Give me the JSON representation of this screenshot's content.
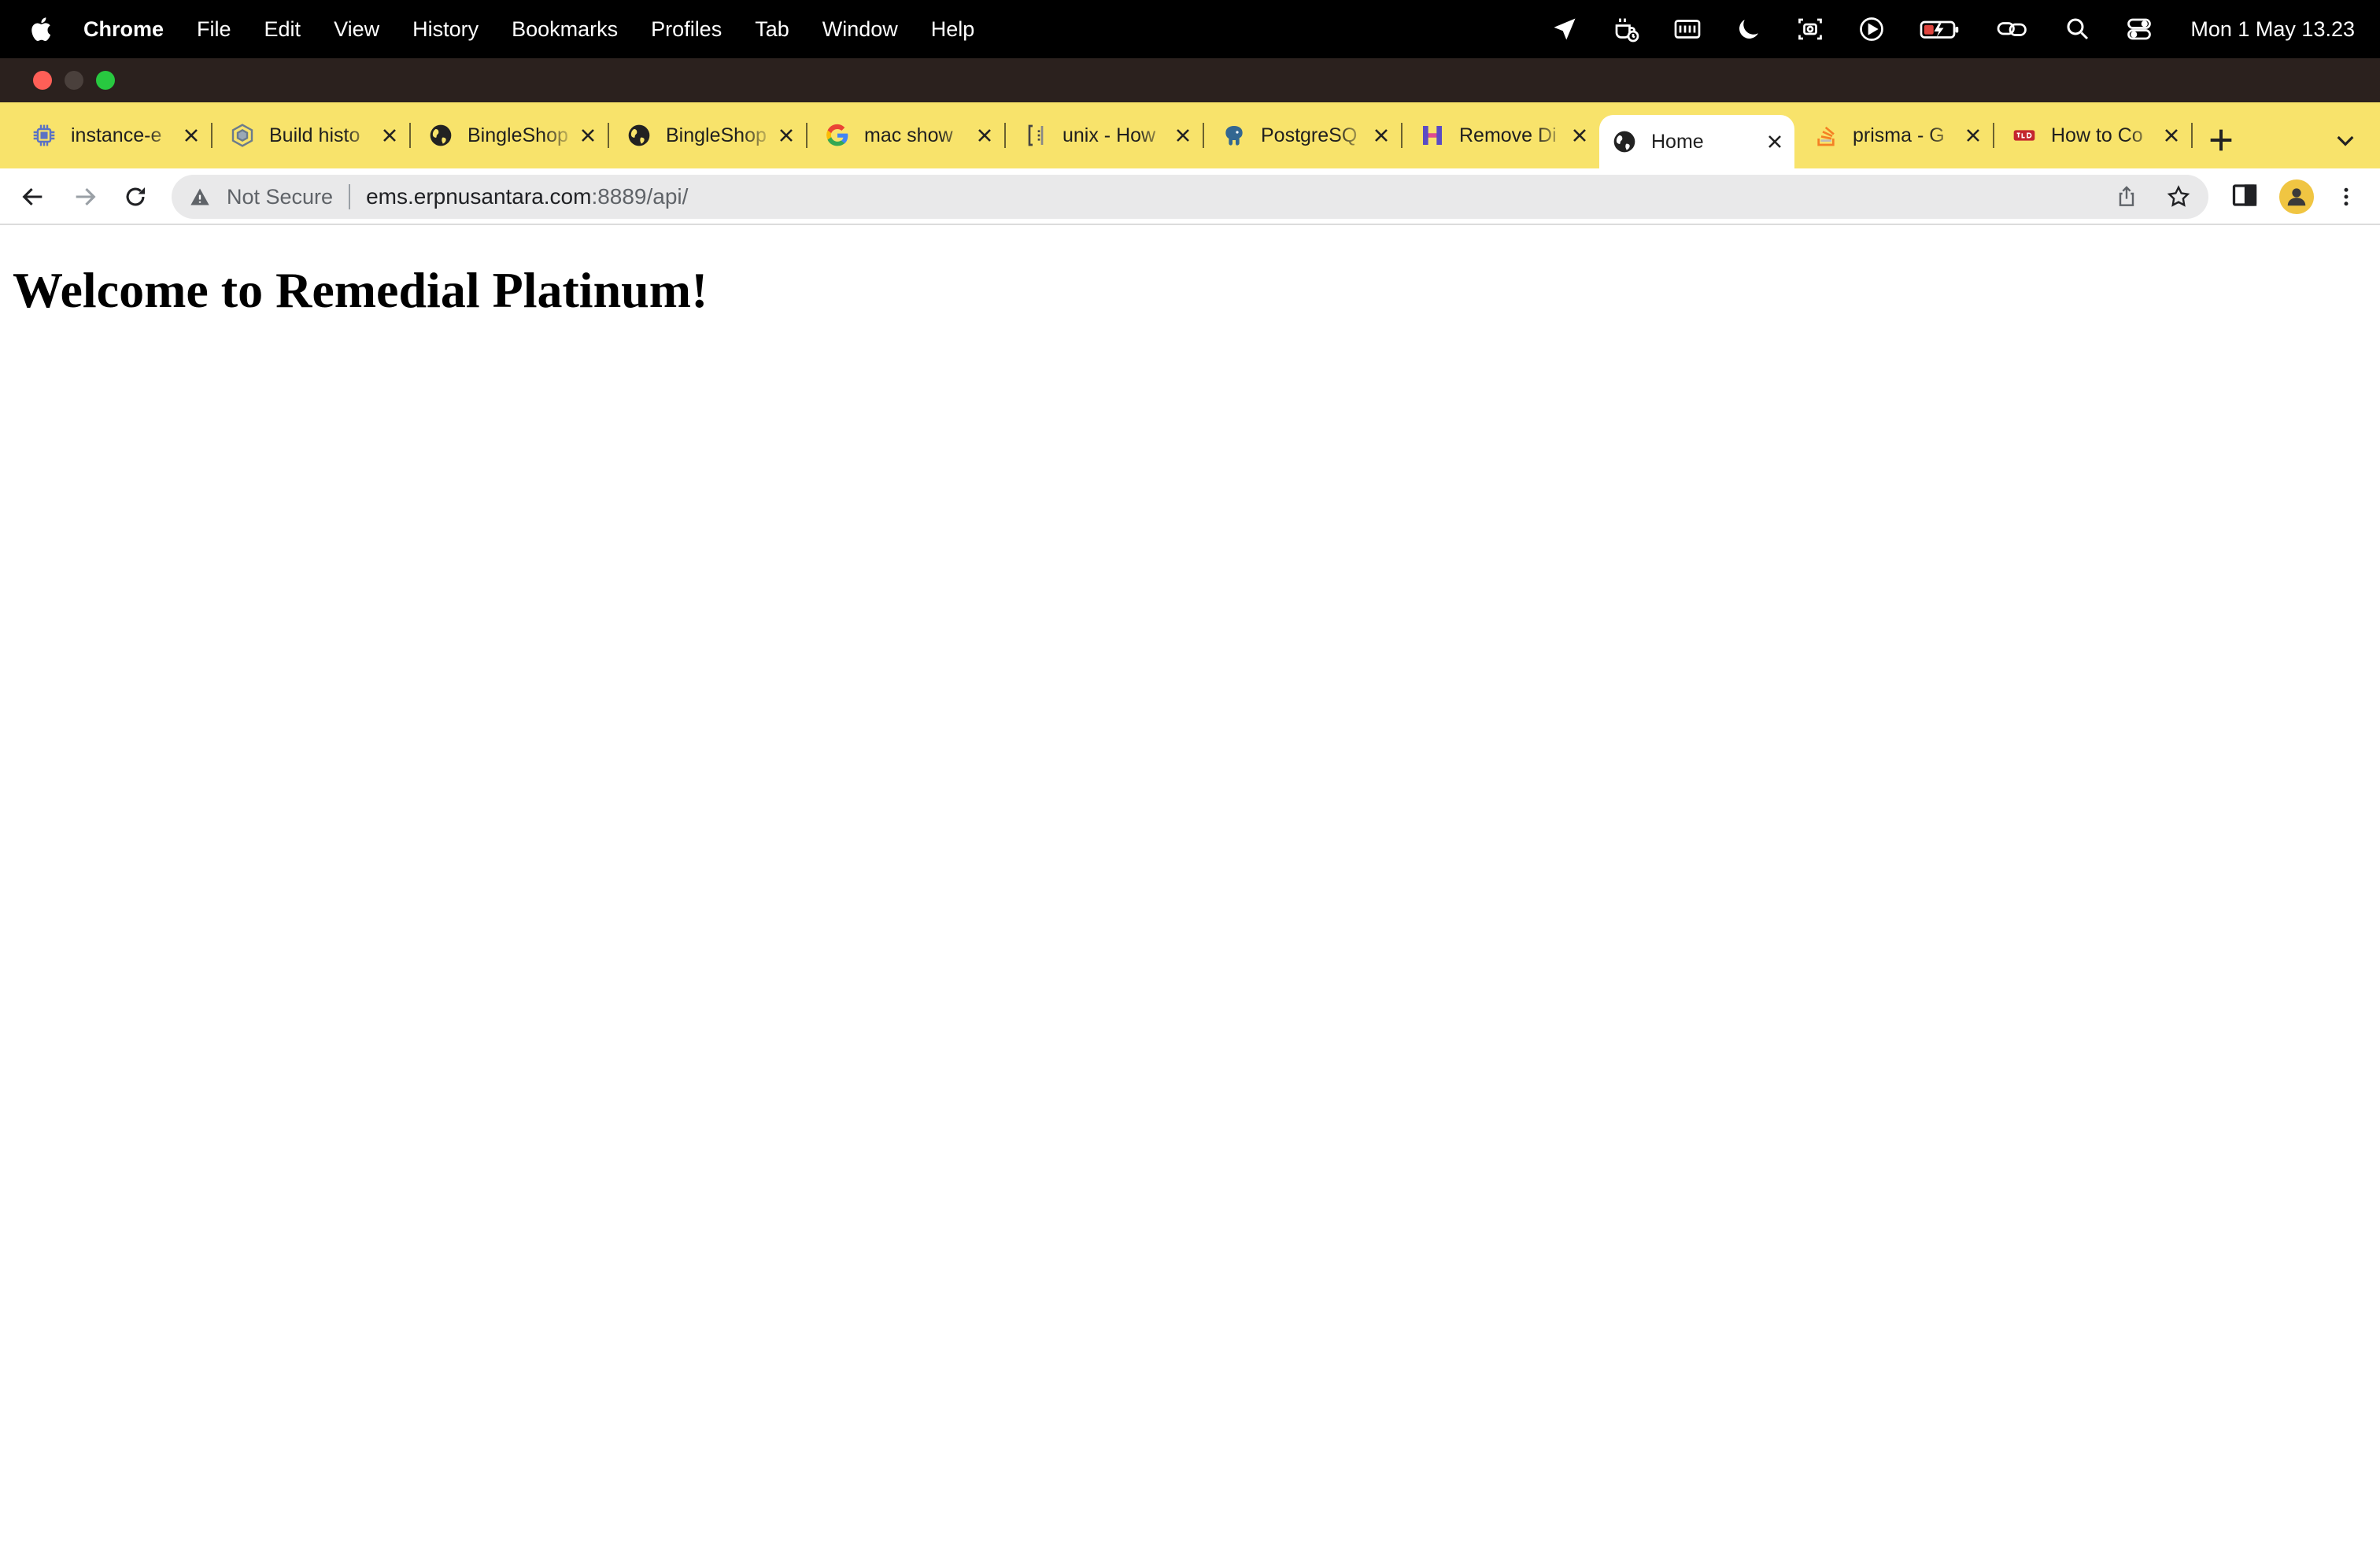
{
  "menubar": {
    "app_name": "Chrome",
    "menus": [
      "File",
      "Edit",
      "View",
      "History",
      "Bookmarks",
      "Profiles",
      "Tab",
      "Window",
      "Help"
    ],
    "status_icons": [
      "location-icon",
      "coffee-timer-icon",
      "keyboard-icon",
      "moon-icon",
      "screenshot-icon",
      "play-icon",
      "battery-charging-icon",
      "link-icon",
      "spotlight-search-icon",
      "control-center-icon"
    ],
    "clock": "Mon 1 May  13.23"
  },
  "tabs": [
    {
      "title": "instance-e",
      "favicon": "chip-icon",
      "active": false
    },
    {
      "title": "Build histo",
      "favicon": "cube-icon",
      "active": false
    },
    {
      "title": "BingleShop",
      "favicon": "globe-icon",
      "active": false
    },
    {
      "title": "BingleShop",
      "favicon": "globe-icon",
      "active": false
    },
    {
      "title": "mac show",
      "favicon": "google-icon",
      "active": false
    },
    {
      "title": "unix - How",
      "favicon": "bracket-icon",
      "active": false
    },
    {
      "title": "PostgreSQ",
      "favicon": "elephant-icon",
      "active": false
    },
    {
      "title": "Remove Di",
      "favicon": "h-logo-icon",
      "active": false
    },
    {
      "title": "Home",
      "favicon": "globe-icon",
      "active": true
    },
    {
      "title": "prisma - G",
      "favicon": "stack-icon",
      "active": false
    },
    {
      "title": "How to Co",
      "favicon": "red-logo-icon",
      "active": false
    }
  ],
  "toolbar": {
    "security_label": "Not Secure",
    "url_host": "ems.erpnusantara.com",
    "url_rest": ":8889/api/"
  },
  "page": {
    "heading": "Welcome to Remedial Platinum!"
  },
  "colors": {
    "tabstrip": "#f8e36b",
    "titlestrip": "#2b211e",
    "avatar": "#f0c542"
  }
}
